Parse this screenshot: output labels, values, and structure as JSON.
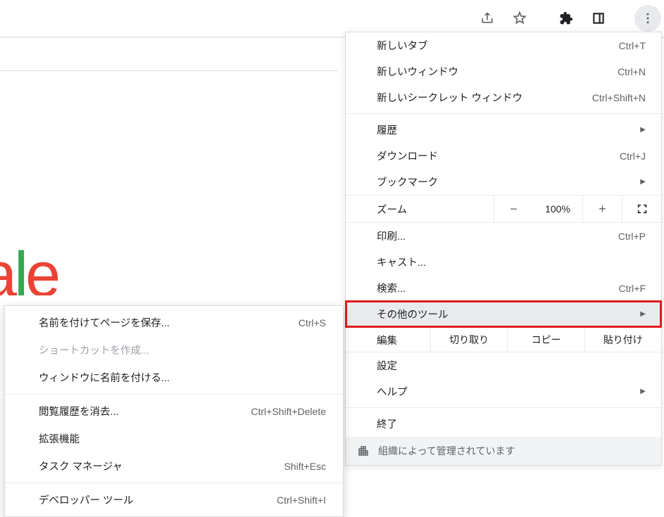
{
  "toolbar": {},
  "menu": {
    "new_tab": {
      "label": "新しいタブ",
      "shortcut": "Ctrl+T"
    },
    "new_window": {
      "label": "新しいウィンドウ",
      "shortcut": "Ctrl+N"
    },
    "new_incognito": {
      "label": "新しいシークレット ウィンドウ",
      "shortcut": "Ctrl+Shift+N"
    },
    "history": {
      "label": "履歴"
    },
    "downloads": {
      "label": "ダウンロード",
      "shortcut": "Ctrl+J"
    },
    "bookmarks": {
      "label": "ブックマーク"
    },
    "zoom": {
      "label": "ズーム",
      "value": "100%"
    },
    "print": {
      "label": "印刷...",
      "shortcut": "Ctrl+P"
    },
    "cast": {
      "label": "キャスト..."
    },
    "find": {
      "label": "検索...",
      "shortcut": "Ctrl+F"
    },
    "more_tools": {
      "label": "その他のツール"
    },
    "edit": {
      "label": "編集",
      "cut": "切り取り",
      "copy": "コピー",
      "paste": "貼り付け"
    },
    "settings": {
      "label": "設定"
    },
    "help": {
      "label": "ヘルプ"
    },
    "exit": {
      "label": "終了"
    },
    "managed": {
      "label": "組織によって管理されています"
    }
  },
  "submenu": {
    "save_as": {
      "label": "名前を付けてページを保存...",
      "shortcut": "Ctrl+S"
    },
    "create_shortcut": {
      "label": "ショートカットを作成..."
    },
    "name_window": {
      "label": "ウィンドウに名前を付ける..."
    },
    "clear_browsing": {
      "label": "閲覧履歴を消去...",
      "shortcut": "Ctrl+Shift+Delete"
    },
    "extensions": {
      "label": "拡張機能"
    },
    "task_manager": {
      "label": "タスク マネージャ",
      "shortcut": "Shift+Esc"
    },
    "dev_tools": {
      "label": "デベロッパー ツール",
      "shortcut": "Ctrl+Shift+I"
    }
  },
  "logo": {
    "g2": "g",
    "l": "l",
    "e": "e"
  }
}
